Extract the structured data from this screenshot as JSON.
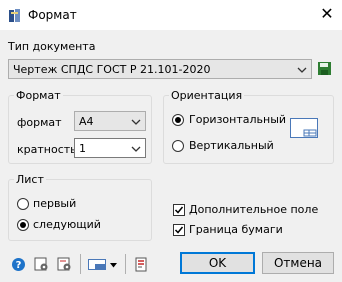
{
  "window": {
    "title": "Формат",
    "close_label": "✕"
  },
  "doc_type": {
    "label": "Тип документа",
    "value": "Чертеж СПДС ГОСТ Р 21.101-2020"
  },
  "format_group": {
    "legend": "Формат",
    "format_label": "формат",
    "format_value": "А4",
    "multiplicity_label": "кратность",
    "multiplicity_value": "1"
  },
  "orientation_group": {
    "legend": "Ориентация",
    "options": [
      {
        "label": "Горизонтальный",
        "selected": true
      },
      {
        "label": "Вертикальный",
        "selected": false
      }
    ]
  },
  "sheet_group": {
    "legend": "Лист",
    "options": [
      {
        "label": "первый",
        "selected": false
      },
      {
        "label": "следующий",
        "selected": true
      }
    ]
  },
  "checkboxes": [
    {
      "label": "Дополнительное поле",
      "checked": true
    },
    {
      "label": "Граница бумаги",
      "checked": true
    }
  ],
  "buttons": {
    "ok": "OK",
    "cancel": "Отмена"
  },
  "icons": [
    "help-icon",
    "settings-icon",
    "sheet-settings-icon",
    "layout-icon",
    "dropdown-arrow-icon",
    "properties-icon",
    "save-icon",
    "orientation-preview-icon"
  ],
  "colors": {
    "accent": "#0078d7",
    "radio_fill": "#000000"
  }
}
